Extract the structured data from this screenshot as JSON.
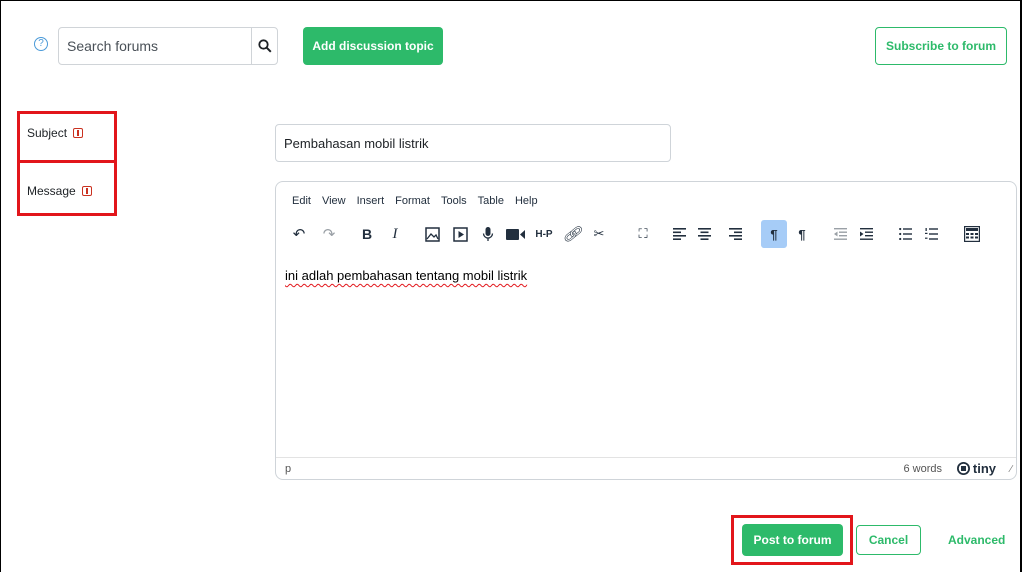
{
  "header": {
    "search_placeholder": "Search forums",
    "add_topic_label": "Add discussion topic",
    "subscribe_label": "Subscribe to forum"
  },
  "form": {
    "subject_label": "Subject",
    "message_label": "Message",
    "subject_value": "Pembahasan mobil listrik"
  },
  "editor": {
    "menu": [
      "Edit",
      "View",
      "Insert",
      "Format",
      "Tools",
      "Table",
      "Help"
    ],
    "content": "ini adlah pembahasan tentang mobil listrik",
    "status_path": "p",
    "word_count": "6 words",
    "brand": "tiny"
  },
  "actions": {
    "post_label": "Post to forum",
    "cancel_label": "Cancel",
    "advanced_label": "Advanced"
  },
  "colors": {
    "primary_green": "#2dba6a",
    "highlight_red": "#e2161b"
  }
}
